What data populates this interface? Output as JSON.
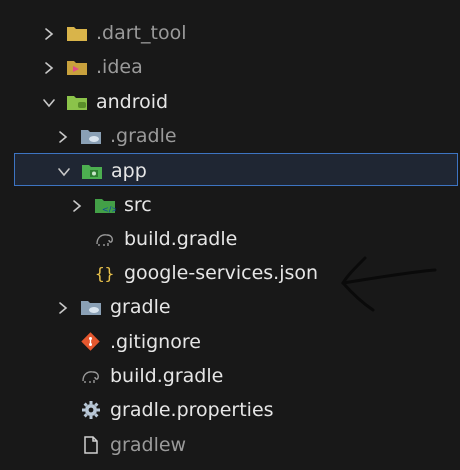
{
  "explorer": {
    "rows": [
      {
        "label": ".dart_tool",
        "dim": true,
        "chevron": "right",
        "icon": "folder-icon",
        "indent": 0
      },
      {
        "label": ".idea",
        "dim": true,
        "chevron": "right",
        "icon": "idea-folder-icon",
        "indent": 0
      },
      {
        "label": "android",
        "dim": false,
        "chevron": "down",
        "icon": "android-folder-icon",
        "indent": 0
      },
      {
        "label": ".gradle",
        "dim": true,
        "chevron": "right",
        "icon": "gradle-folder-icon",
        "indent": 1
      },
      {
        "label": "app",
        "dim": false,
        "chevron": "down",
        "icon": "app-folder-icon",
        "indent": 1,
        "selected": true
      },
      {
        "label": "src",
        "dim": false,
        "chevron": "right",
        "icon": "src-folder-icon",
        "indent": 2
      },
      {
        "label": "build.gradle",
        "dim": false,
        "chevron": "none",
        "icon": "gradle-elephant-icon",
        "indent": 2
      },
      {
        "label": "google-services.json",
        "dim": false,
        "chevron": "none",
        "icon": "json-braces-icon",
        "indent": 2
      },
      {
        "label": "gradle",
        "dim": false,
        "chevron": "right",
        "icon": "gradle-folder-icon",
        "indent": 1
      },
      {
        "label": ".gitignore",
        "dim": false,
        "chevron": "none",
        "icon": "git-icon",
        "indent": 1
      },
      {
        "label": "build.gradle",
        "dim": false,
        "chevron": "none",
        "icon": "gradle-elephant-icon",
        "indent": 1
      },
      {
        "label": "gradle.properties",
        "dim": false,
        "chevron": "none",
        "icon": "gear-icon",
        "indent": 1
      },
      {
        "label": "gradlew",
        "dim": true,
        "chevron": "none",
        "icon": "file-icon",
        "indent": 1
      }
    ]
  },
  "colors": {
    "background": "#181818",
    "text": "#e6e6e6",
    "text_dim": "#9a9a9a",
    "selection_border": "#3d74c2",
    "json_icon": "#e8c14b",
    "git_icon": "#e4572e",
    "folder_yellow": "#d9b44a",
    "folder_green": "#8bc34a",
    "folder_gray": "#8aa0b5"
  }
}
